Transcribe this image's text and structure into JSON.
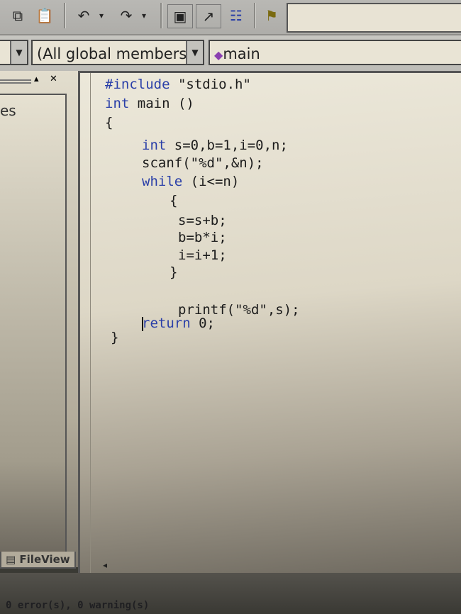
{
  "toolbar": {
    "icons": [
      "copy-icon",
      "paste-icon",
      "undo-icon",
      "redo-icon",
      "workspace-icon",
      "output-window-icon",
      "window-list-icon",
      "find-in-files-icon"
    ],
    "undo_dropdown": "▾",
    "redo_dropdown": "▾"
  },
  "combos": {
    "scope": "(All global members",
    "function": "main",
    "function_icon": "purple-diamond-member-icon"
  },
  "left_pane": {
    "item_text": "es",
    "tab_label": "FileView"
  },
  "editor": {
    "lines": [
      [
        {
          "t": "#include",
          "k": "kw"
        },
        {
          "t": " \"stdio.h\"",
          "k": ""
        }
      ],
      [
        {
          "t": "int",
          "k": "kw"
        },
        {
          "t": " main ()",
          "k": ""
        }
      ],
      [
        {
          "t": "{",
          "k": ""
        }
      ],
      [
        {
          "t": "int",
          "k": "kw"
        },
        {
          "t": " s=0,b=1,i=0,n;",
          "k": ""
        }
      ],
      [
        {
          "t": "scanf(\"%d\",&n);",
          "k": ""
        }
      ],
      [
        {
          "t": "while",
          "k": "kw"
        },
        {
          "t": " (i<=n)",
          "k": ""
        }
      ],
      [
        {
          "t": "{",
          "k": ""
        }
      ],
      [
        {
          "t": "s=s+b;",
          "k": ""
        }
      ],
      [
        {
          "t": "b=b*i;",
          "k": ""
        }
      ],
      [
        {
          "t": "i=i+1;",
          "k": ""
        }
      ],
      [
        {
          "t": "}",
          "k": ""
        }
      ],
      [
        {
          "t": "printf(\"%d\",s);",
          "k": ""
        }
      ],
      [
        {
          "t": "return",
          "k": "kw"
        },
        {
          "t": " 0;",
          "k": ""
        }
      ],
      [
        {
          "t": "}",
          "k": ""
        }
      ]
    ]
  },
  "output": {
    "status": "0 error(s), 0 warning(s)"
  },
  "colors": {
    "keyword": "#2a3fa8",
    "editor_bg": "#ece8da"
  }
}
